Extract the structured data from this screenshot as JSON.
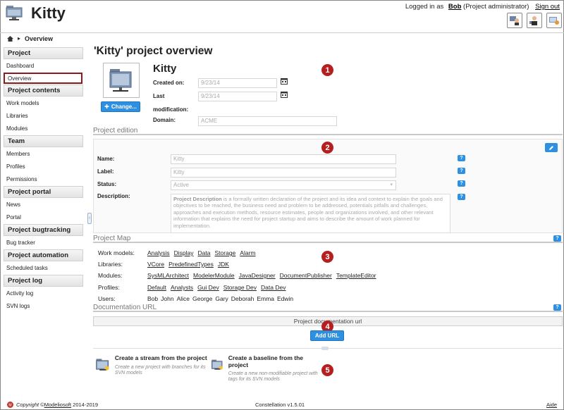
{
  "app": {
    "title": "Kitty"
  },
  "header": {
    "logged_in_prefix": "Logged in as",
    "user": "Bob",
    "role": "(Project administrator)",
    "sign_out": "Sign out",
    "icons": [
      "user-config-icon",
      "user-profile-icon",
      "screen-config-icon"
    ]
  },
  "breadcrumb": {
    "current": "Overview"
  },
  "sidebar": {
    "sections": [
      {
        "title": "Project",
        "items": [
          "Dashboard",
          "Overview"
        ]
      },
      {
        "title": "Project contents",
        "items": [
          "Work models",
          "Libraries",
          "Modules"
        ]
      },
      {
        "title": "Team",
        "items": [
          "Members",
          "Profiles",
          "Permissions"
        ]
      },
      {
        "title": "Project portal",
        "items": [
          "News",
          "Portal"
        ]
      },
      {
        "title": "Project bugtracking",
        "items": [
          "Bug tracker"
        ]
      },
      {
        "title": "Project automation",
        "items": [
          "Scheduled tasks"
        ]
      },
      {
        "title": "Project log",
        "items": [
          "Activity log",
          "SVN logs"
        ]
      }
    ],
    "active": "Overview"
  },
  "overview": {
    "title": "'Kitty' project overview",
    "project_name": "Kitty",
    "change_button": "Change...",
    "created_on_label": "Created on:",
    "created_on": "9/23/14",
    "last_mod_label_1": "Last",
    "last_mod_label_2": "modification:",
    "last_mod": "9/23/14",
    "domain_label": "Domain:",
    "domain": "ACME"
  },
  "badges": [
    "1",
    "2",
    "3",
    "4",
    "5"
  ],
  "edition": {
    "section_title": "Project edition",
    "name_label": "Name:",
    "name": "Kitty",
    "label_label": "Label:",
    "label": "Kitty",
    "status_label": "Status:",
    "status": "Active",
    "description_label": "Description:",
    "description_bold": "Project Description",
    "description_text": " is a formally written declaration of the project and its idea and context to explain the goals and objectives to be reached, the business need and problem to be addressed, potentials pitfalls and challenges, approaches and execution methods, resource estimates, people and organizations involved, and other relevant information that explains the need for project startup and aims to describe the amount of work planned for implementation."
  },
  "project_map": {
    "section_title": "Project Map",
    "rows": [
      {
        "label": "Work models:",
        "values": [
          "Analysis",
          "Display",
          "Data",
          "Storage",
          "Alarm"
        ],
        "links": true
      },
      {
        "label": "Libraries:",
        "values": [
          "VCore",
          "PredefinedTypes",
          "JDK"
        ],
        "links": true
      },
      {
        "label": "Modules:",
        "values": [
          "SysMLArchitect",
          "ModelerModule",
          "JavaDesigner",
          "DocumentPublisher",
          "TemplateEditor"
        ],
        "links": true
      },
      {
        "label": "Profiles:",
        "values": [
          "Default",
          "Analysts",
          "Gui Dev",
          "Storage Dev",
          "Data Dev"
        ],
        "links": true
      },
      {
        "label": "Users:",
        "values": [
          "Bob",
          "John",
          "Alice",
          "George",
          "Gary",
          "Deborah",
          "Emma",
          "Edwin"
        ],
        "links": false
      }
    ]
  },
  "documentation": {
    "section_title": "Documentation URL",
    "column_header": "Project documentation url",
    "add_button": "Add URL"
  },
  "actions": [
    {
      "title": "Create a stream from the project",
      "subtitle": "Create a new project with branches for its SVN models"
    },
    {
      "title": "Create a baseline from the project",
      "subtitle": "Create a new non-modifiable project with tags for its SVN models"
    }
  ],
  "footer": {
    "copyright": "Copyright ©",
    "company": "Modeliosoft",
    "years": " 2014-2019",
    "version": "Constellation v1.5.01",
    "help": "Aide"
  },
  "colors": {
    "accent": "#2f8fe0",
    "badge": "#b51f1f",
    "active_border": "#8b1a1a"
  }
}
